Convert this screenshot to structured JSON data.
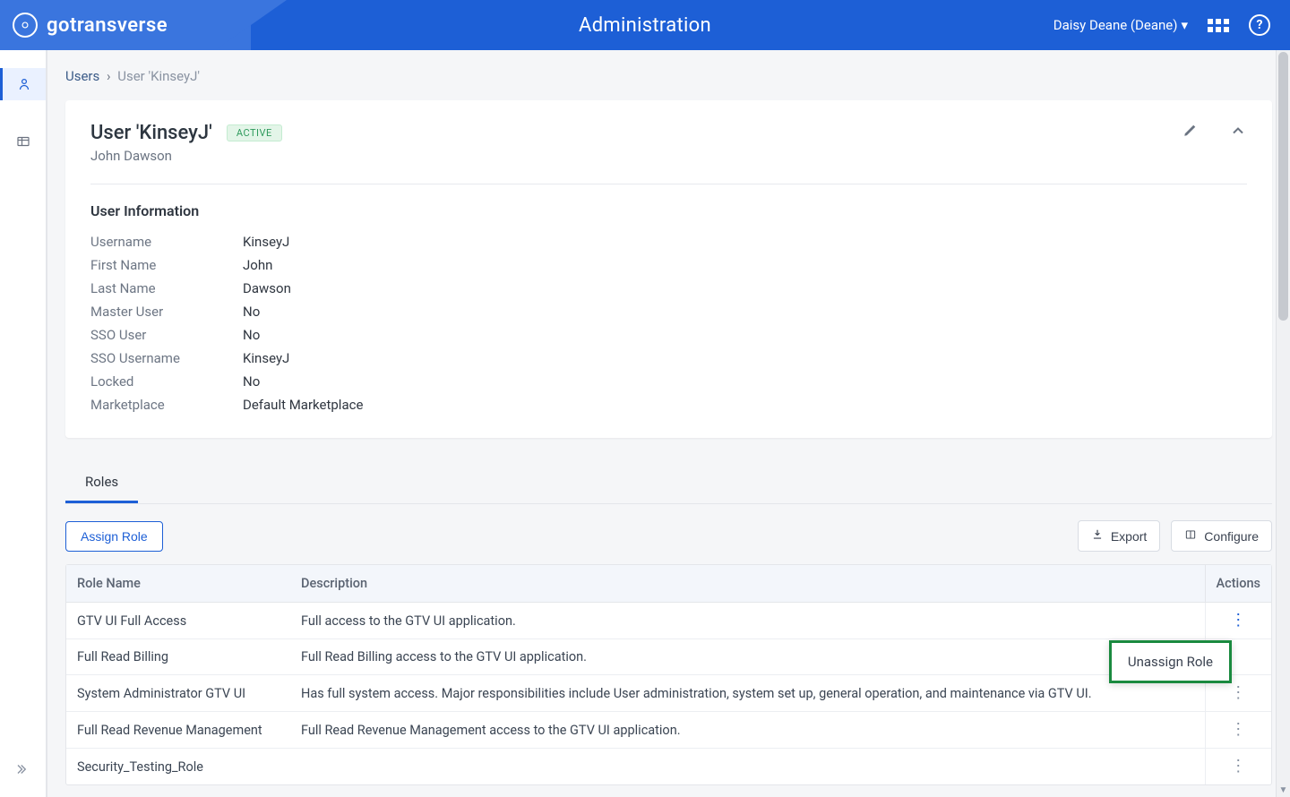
{
  "header": {
    "brand": "gotransverse",
    "title": "Administration",
    "user_label": "Daisy Deane (Deane)"
  },
  "breadcrumb": {
    "root": "Users",
    "current": "User 'KinseyJ'"
  },
  "user_card": {
    "title": "User 'KinseyJ'",
    "badge": "ACTIVE",
    "subtitle": "John Dawson",
    "section_title": "User Information",
    "fields": {
      "username_k": "Username",
      "username_v": "KinseyJ",
      "first_k": "First Name",
      "first_v": "John",
      "last_k": "Last Name",
      "last_v": "Dawson",
      "master_k": "Master User",
      "master_v": "No",
      "sso_k": "SSO User",
      "sso_v": "No",
      "ssouser_k": "SSO Username",
      "ssouser_v": "KinseyJ",
      "locked_k": "Locked",
      "locked_v": "No",
      "market_k": "Marketplace",
      "market_v": "Default Marketplace"
    }
  },
  "tabs": {
    "roles": "Roles"
  },
  "toolbar": {
    "assign_role": "Assign Role",
    "export": "Export",
    "configure": "Configure"
  },
  "table": {
    "col_role": "Role Name",
    "col_desc": "Description",
    "col_actions": "Actions",
    "rows": [
      {
        "name": "GTV UI Full Access",
        "desc": "Full access to the GTV UI application."
      },
      {
        "name": "Full Read Billing",
        "desc": "Full Read Billing access to the GTV UI application."
      },
      {
        "name": "System Administrator GTV UI",
        "desc": "Has full system access. Major responsibilities include User administration, system set up, general operation, and maintenance via GTV UI."
      },
      {
        "name": "Full Read Revenue Management",
        "desc": "Full Read Revenue Management access to the GTV UI application."
      },
      {
        "name": "Security_Testing_Role",
        "desc": ""
      }
    ]
  },
  "popup": {
    "unassign": "Unassign Role"
  }
}
